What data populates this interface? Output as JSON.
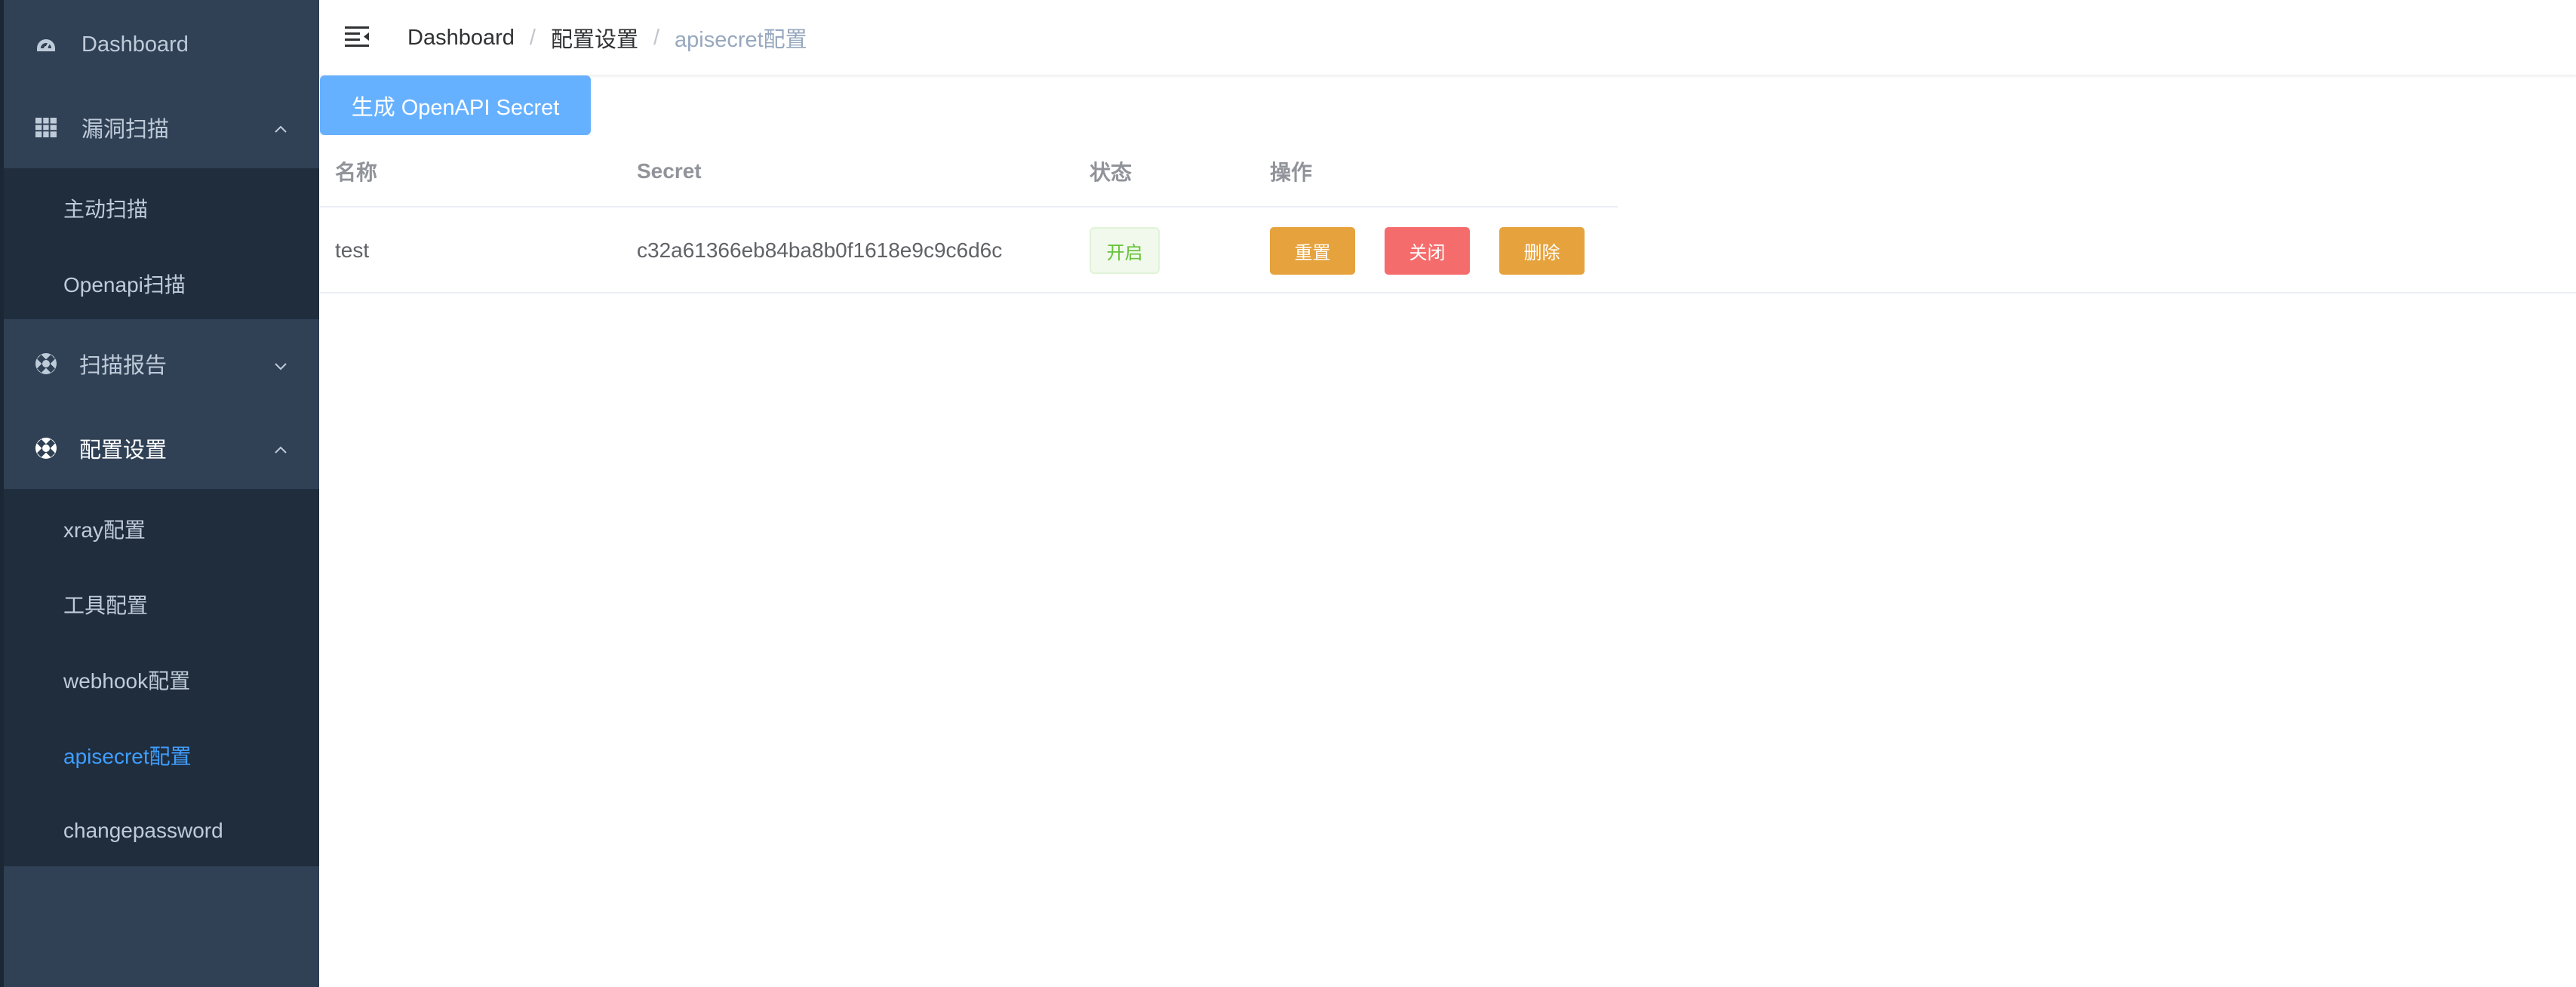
{
  "sidebar": {
    "items": [
      {
        "label": "Dashboard",
        "icon": "dashboard-icon"
      },
      {
        "label": "漏洞扫描",
        "icon": "table-grid-icon",
        "expanded": true,
        "children": [
          {
            "label": "主动扫描"
          },
          {
            "label": "Openapi扫描"
          }
        ]
      },
      {
        "label": "扫描报告",
        "icon": "component-icon",
        "expanded": false
      },
      {
        "label": "配置设置",
        "icon": "component-icon",
        "expanded": true,
        "children": [
          {
            "label": "xray配置"
          },
          {
            "label": "工具配置"
          },
          {
            "label": "webhook配置"
          },
          {
            "label": "apisecret配置",
            "active": true
          },
          {
            "label": "changepassword"
          }
        ]
      }
    ]
  },
  "breadcrumb": {
    "items": [
      "Dashboard",
      "配置设置",
      "apisecret配置"
    ],
    "separator": "/"
  },
  "toolbar": {
    "generate_label": "生成 OpenAPI Secret"
  },
  "table": {
    "columns": [
      "名称",
      "Secret",
      "状态",
      "操作"
    ],
    "rows": [
      {
        "name": "test",
        "secret": "c32a61366eb84ba8b0f1618e9c9c6d6c",
        "status": "开启",
        "actions": {
          "reset": "重置",
          "close": "关闭",
          "delete": "删除"
        }
      }
    ]
  },
  "colors": {
    "sidebar_bg": "#304156",
    "submenu_bg": "#1f2d3d",
    "active": "#409eff",
    "primary_button": "#66b1ff",
    "warning": "#e6a23c",
    "danger": "#f56c6c",
    "success": "#67c23a"
  }
}
